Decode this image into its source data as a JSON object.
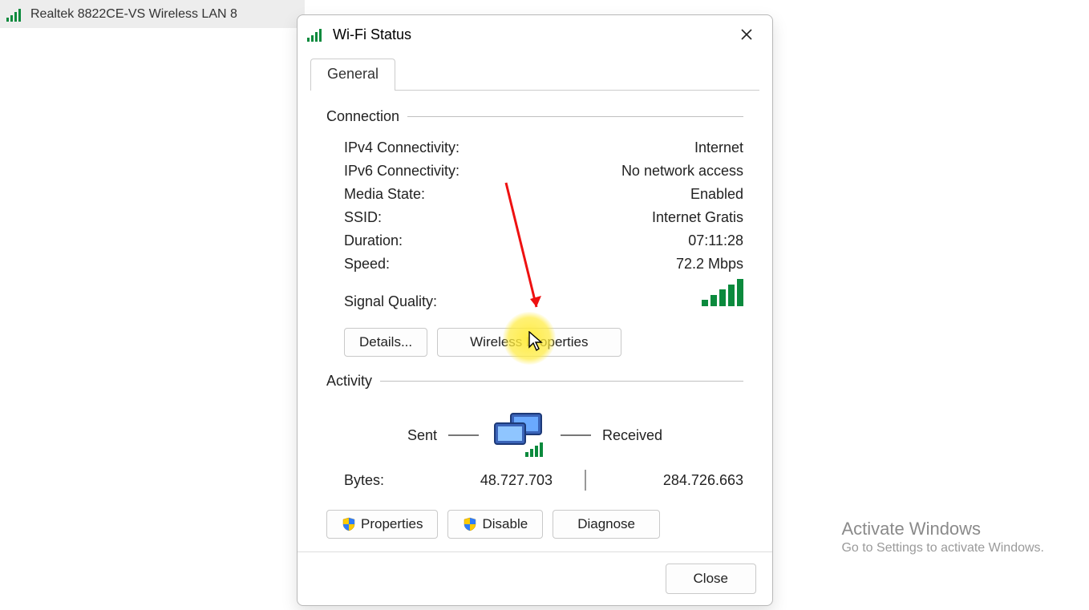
{
  "bgItem": {
    "adapter_line": "Realtek 8822CE-VS Wireless LAN 8"
  },
  "dialog": {
    "title": "Wi-Fi Status"
  },
  "tab": {
    "general": "General"
  },
  "connection": {
    "header": "Connection",
    "ipv4_label": "IPv4 Connectivity:",
    "ipv4_value": "Internet",
    "ipv6_label": "IPv6 Connectivity:",
    "ipv6_value": "No network access",
    "media_label": "Media State:",
    "media_value": "Enabled",
    "ssid_label": "SSID:",
    "ssid_value": "Internet Gratis",
    "duration_label": "Duration:",
    "duration_value": "07:11:28",
    "speed_label": "Speed:",
    "speed_value": "72.2 Mbps",
    "signal_label": "Signal Quality:"
  },
  "buttons": {
    "details": "Details...",
    "wireless_props": "Wireless Properties",
    "properties": "Properties",
    "disable": "Disable",
    "diagnose": "Diagnose",
    "close": "Close"
  },
  "activity": {
    "header": "Activity",
    "sent": "Sent",
    "received": "Received",
    "bytes_label": "Bytes:",
    "bytes_sent": "48.727.703",
    "bytes_received": "284.726.663"
  },
  "watermark": {
    "line1": "Activate Windows",
    "line2": "Go to Settings to activate Windows."
  }
}
